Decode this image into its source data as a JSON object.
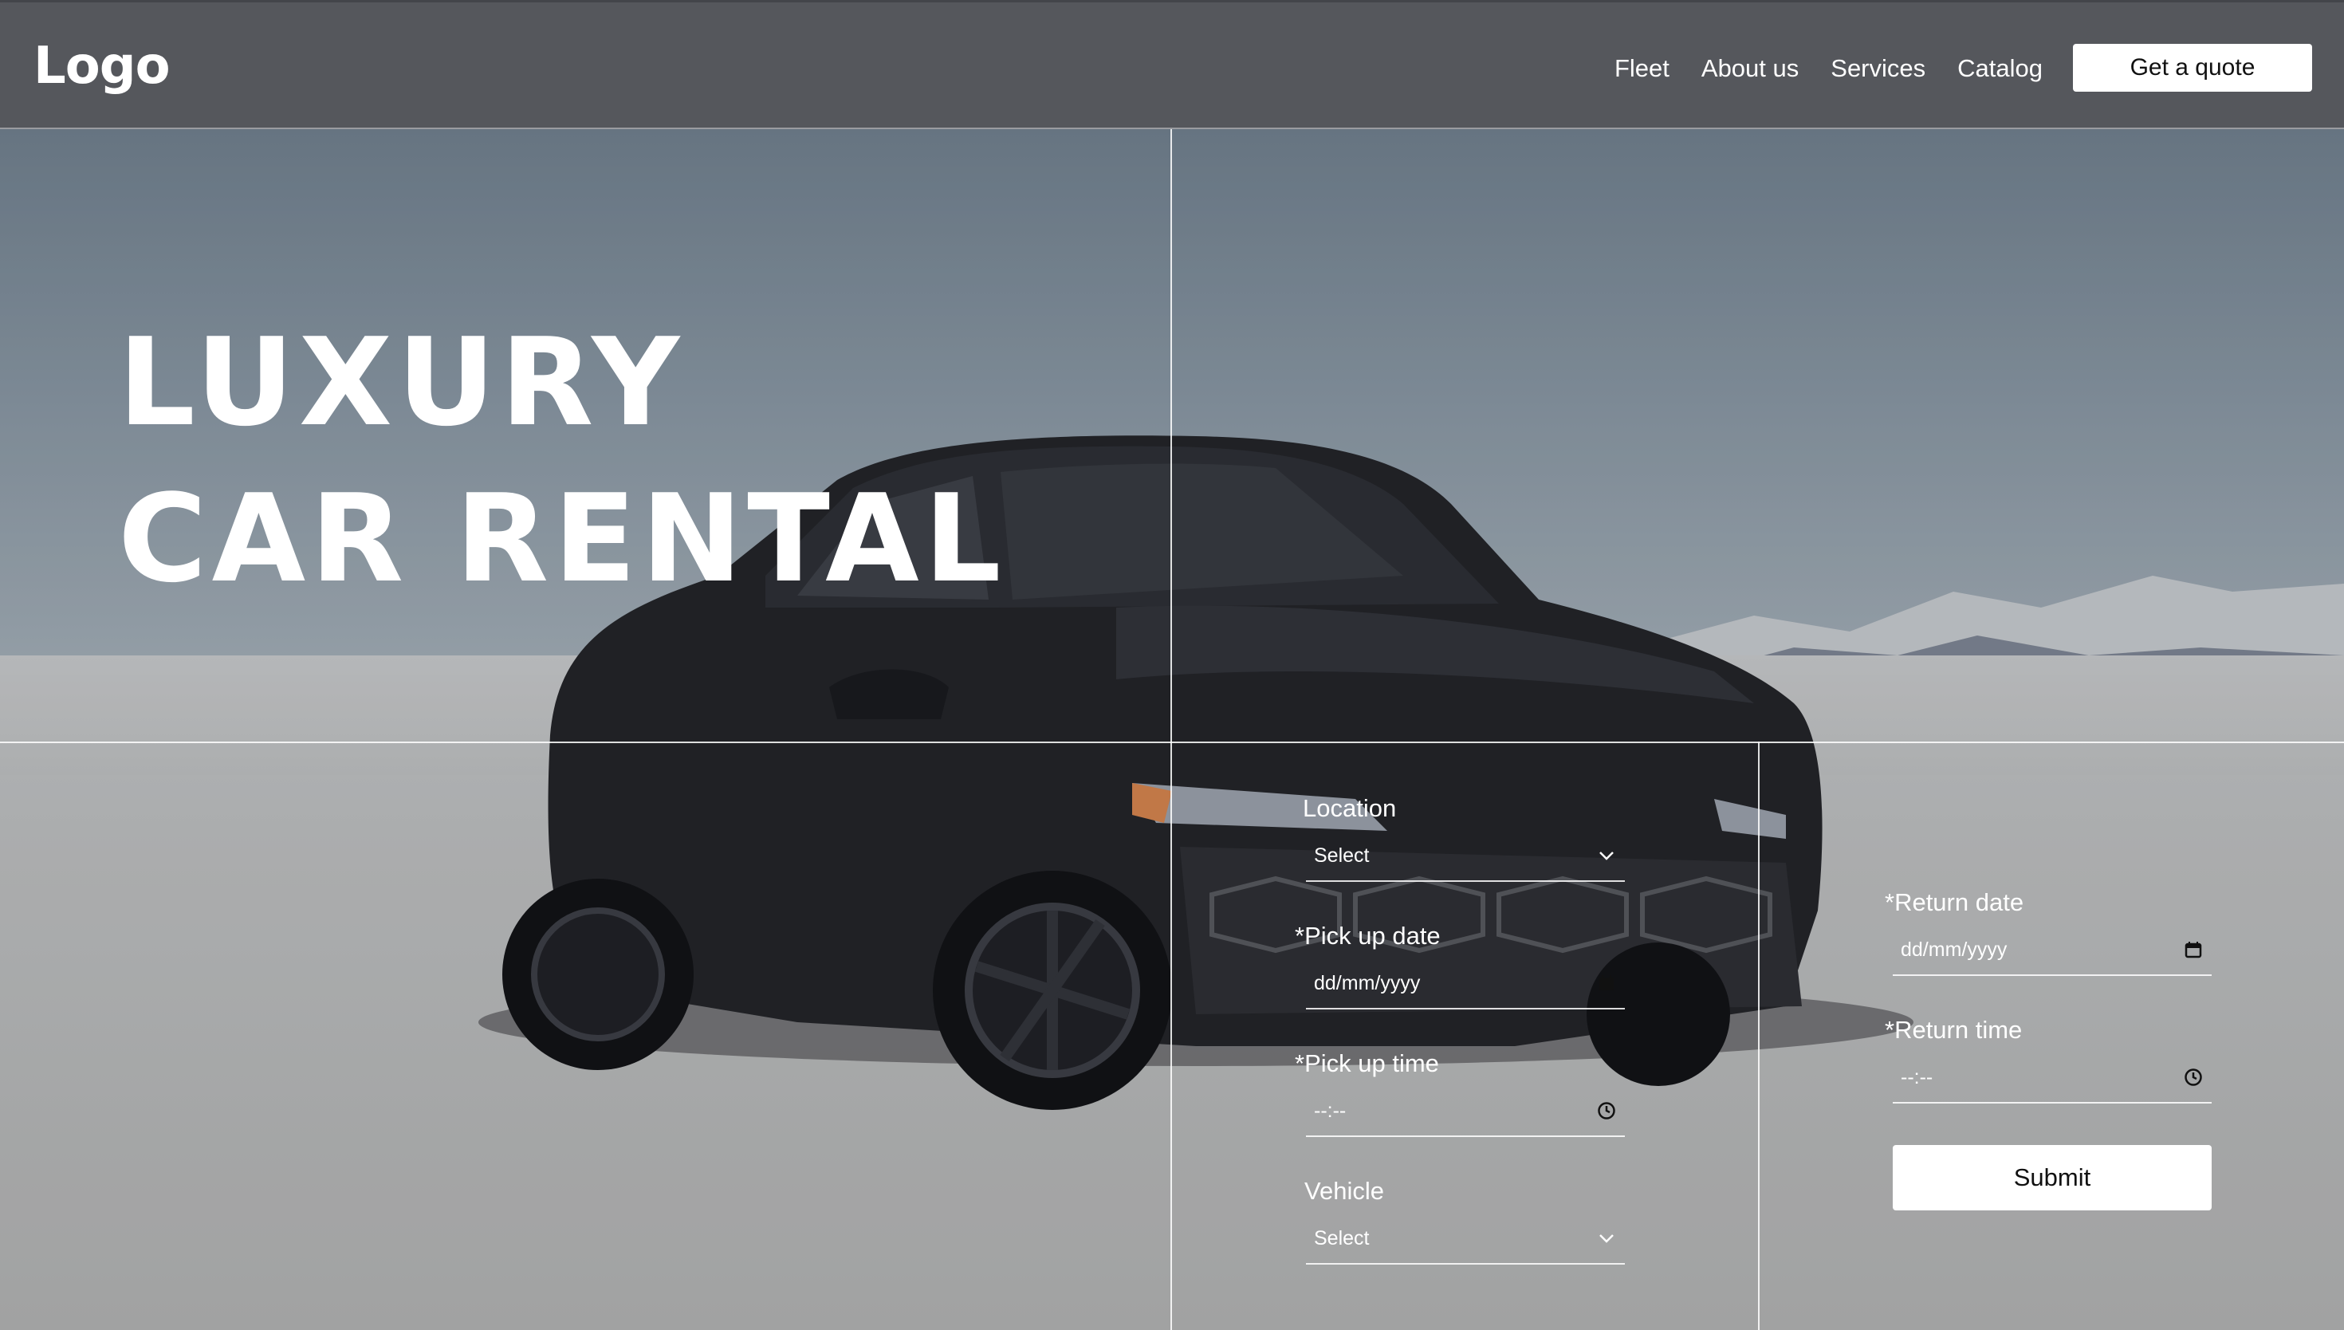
{
  "header": {
    "logo": "Logo",
    "nav": [
      {
        "label": "Fleet"
      },
      {
        "label": "About us"
      },
      {
        "label": "Services"
      },
      {
        "label": "Catalog"
      }
    ],
    "cta_label": "Get a quote"
  },
  "hero": {
    "title_line1": "LUXURY",
    "title_line2": "CAR RENTAL"
  },
  "form": {
    "location": {
      "label": "Location",
      "value": "Select",
      "icon": "chevron-down-icon"
    },
    "pickup_date": {
      "label": "*Pick up date",
      "value": "dd/mm/yyyy",
      "icon": "calendar-icon"
    },
    "pickup_time": {
      "label": "*Pick up time",
      "value": "--:--",
      "icon": "clock-icon"
    },
    "vehicle": {
      "label": "Vehicle",
      "value": "Select",
      "icon": "chevron-down-icon"
    },
    "return_date": {
      "label": "*Return date",
      "value": "dd/mm/yyyy",
      "icon": "calendar-icon"
    },
    "return_time": {
      "label": "*Return time",
      "value": "--:--",
      "icon": "clock-icon"
    },
    "submit_label": "Submit"
  },
  "colors": {
    "header_bg": "#55575c",
    "button_bg": "#ffffff",
    "button_text": "#111111"
  }
}
